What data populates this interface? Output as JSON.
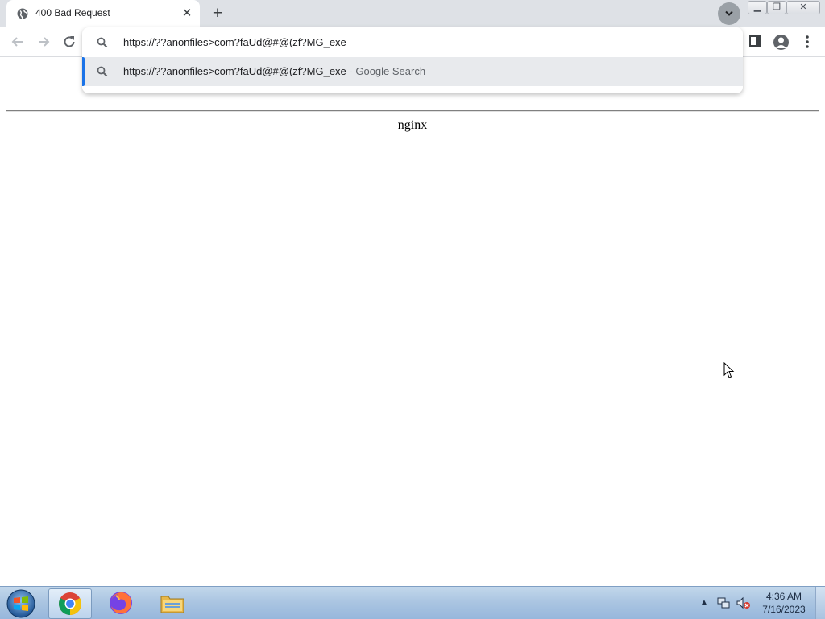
{
  "browser": {
    "tab": {
      "title": "400 Bad Request",
      "favicon": "globe-icon",
      "close": "✕"
    },
    "new_tab": "+",
    "toolbar_icons": [
      "back-arrow-icon",
      "forward-arrow-icon",
      "reload-icon",
      "side-panel-icon",
      "profile-icon",
      "menu-icon"
    ]
  },
  "omnibox": {
    "value": "https://??anonfiles>com?faUd@#@(zf?MG_exe",
    "suggestion": {
      "query": "https://??anonfiles>com?faUd@#@(zf?MG_exe",
      "separator": " - ",
      "engine": "Google Search"
    }
  },
  "page": {
    "server": "nginx"
  },
  "taskbar": {
    "apps": [
      "chrome-icon",
      "firefox-icon",
      "file-explorer-icon"
    ],
    "tray_arrow": "▲",
    "clock": {
      "time": "4:36 AM",
      "date": "7/16/2023"
    }
  },
  "colors": {
    "tab_strip": "#dee1e6",
    "suggestion_highlight": "#e8eaed",
    "accent": "#1a73e8",
    "taskbar": "#a9c4e1"
  }
}
